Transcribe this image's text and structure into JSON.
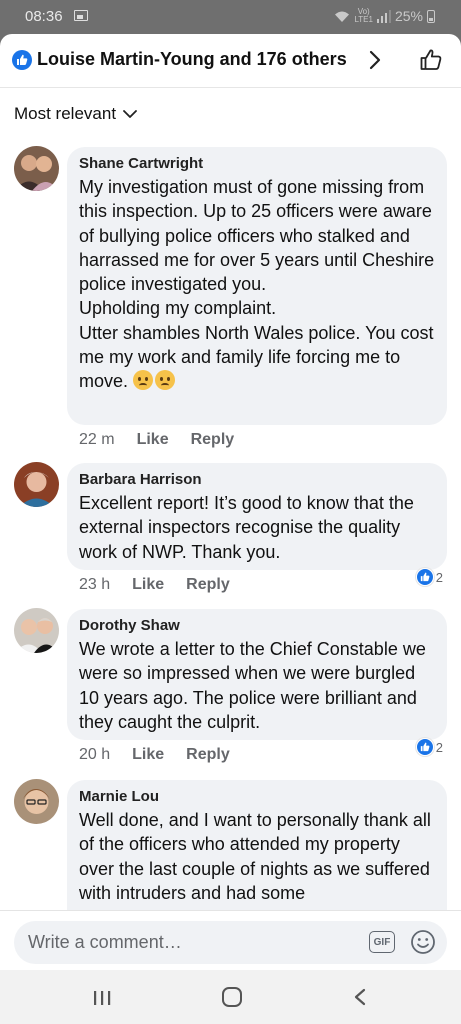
{
  "status": {
    "time": "08:36",
    "volte": "Vo)\nLTE1",
    "battery": "25%"
  },
  "header": {
    "title": "Louise Martin-Young and 176 others"
  },
  "sort": {
    "label": "Most relevant"
  },
  "comments": [
    {
      "author": "Shane Cartwright",
      "text": "My investigation must of gone missing from this inspection. Up to 25 officers were aware of bullying police officers who stalked and harrassed me for over 5 years until Cheshire police investigated you.\nUpholding my complaint.\nUtter shambles North Wales police. You cost me my work and family life forcing me to move.",
      "time": "22 m",
      "like": "Like",
      "reply": "Reply",
      "reactions": ""
    },
    {
      "author": "Barbara Harrison",
      "text": "Excellent report! It’s good to know that the external inspectors recognise the quality work of NWP. Thank you.",
      "time": "23 h",
      "like": "Like",
      "reply": "Reply",
      "reactions": "2"
    },
    {
      "author": "Dorothy Shaw",
      "text": "We wrote a letter to the Chief Constable we were so impressed when we were burgled 10 years ago. The police were brilliant and they caught the culprit.",
      "time": "20 h",
      "like": "Like",
      "reply": "Reply",
      "reactions": "2"
    },
    {
      "author": "Marnie Lou",
      "text": "Well done, and I want to personally thank all of the officers who attended my property over the last couple of nights as we suffered with intruders and had some",
      "time": "",
      "like": "",
      "reply": "",
      "reactions": ""
    }
  ],
  "compose": {
    "placeholder": "Write a comment…",
    "gif": "GIF"
  },
  "icons": {
    "status": [
      "image-icon",
      "wifi-icon",
      "signal-icon",
      "battery-icon"
    ],
    "header": [
      "like-badge-icon",
      "chevron-right-icon",
      "thumbs-up-icon"
    ],
    "compose": [
      "gif-icon",
      "emoji-icon"
    ],
    "nav": [
      "recent-apps-icon",
      "home-icon",
      "back-icon"
    ]
  },
  "colors": {
    "accent": "#1a74e8",
    "bubble": "#f0f2f5",
    "meta": "#65676b"
  }
}
